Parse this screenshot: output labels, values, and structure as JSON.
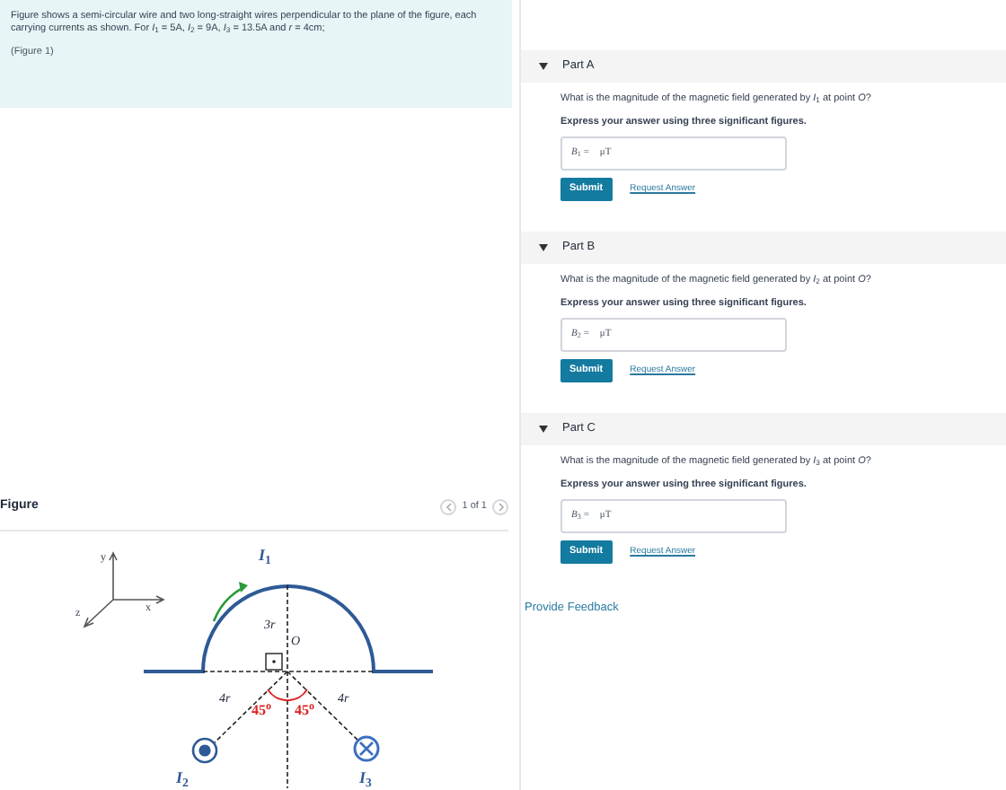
{
  "intro": {
    "text": "Figure shows a semi-circular wire and two long-straight wires perpendicular to the plane of the figure, each carrying currents as shown. For *I*$_{1}$ = 5A, *I*$_{2}$ = 9A, *I*$_{3}$ = 13.5A and *r* = 4cm;",
    "link": "(Figure 1)"
  },
  "figure": {
    "title": "Figure",
    "pager": "1 of 1",
    "labels": [
      "y",
      "x",
      "z",
      "*I*$_{1}$",
      "3r",
      "*O*",
      "4r",
      "4r",
      "45$^{o}$",
      "45$^{o}$",
      "*I*$_{2}$",
      "*I*$_{3}$"
    ]
  },
  "parts": [
    {
      "title": "Part A",
      "expanded": true,
      "question": "What is the magnitude of the magnetic field generated by *I*$_{1}$ at point *O*?",
      "instruction": "Express your answer using three significant figures.",
      "answer_label": "*B*$_{1}$ =",
      "unit": "μT",
      "submit": "Submit",
      "request": "Request Answer"
    },
    {
      "title": "Part B",
      "expanded": true,
      "question": "What is the magnitude of the magnetic field generated by *I*$_{2}$ at point *O*?",
      "instruction": "Express your answer using three significant figures.",
      "answer_label": "*B*$_{2}$ =",
      "unit": "μT",
      "submit": "Submit",
      "request": "Request Answer"
    },
    {
      "title": "Part C",
      "expanded": true,
      "question": "What is the magnitude of the magnetic field generated by *I*$_{3}$ at point *O*?",
      "instruction": "Express your answer using three significant figures.",
      "answer_label": "*B*$_{3}$ =",
      "unit": "μT",
      "submit": "Submit",
      "request": "Request Answer"
    }
  ],
  "feedback": "Provide Feedback"
}
